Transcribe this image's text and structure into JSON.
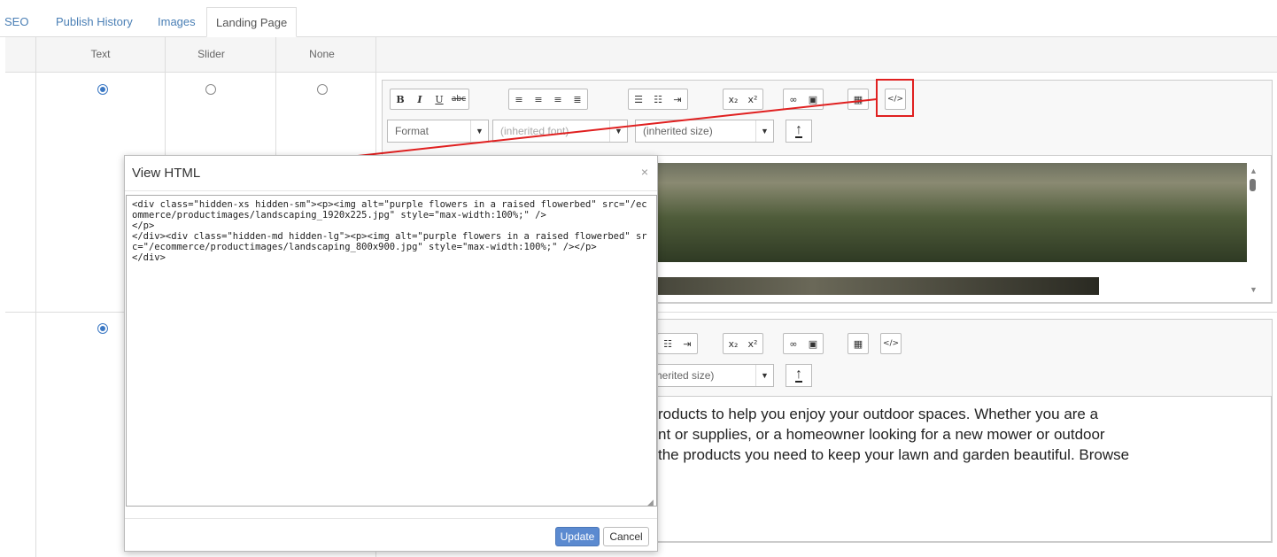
{
  "tabs": [
    {
      "label": "SEO"
    },
    {
      "label": "Publish History"
    },
    {
      "label": "Images"
    },
    {
      "label": "Landing Page",
      "active": true
    }
  ],
  "table": {
    "headers": [
      "Text",
      "Slider",
      "None"
    ]
  },
  "editor": {
    "format_label": "Format",
    "font_label": "(inherited font)",
    "size_label": "(inherited size)",
    "size_label_partial": "herited size)"
  },
  "modal": {
    "title": "View HTML",
    "close_glyph": "×",
    "html_content": "<div class=\"hidden-xs hidden-sm\"><p><img alt=\"purple flowers in a raised flowerbed\" src=\"/ecommerce/productimages/landscaping_1920x225.jpg\" style=\"max-width:100%;\" />\n</p>\n</div><div class=\"hidden-md hidden-lg\"><p><img alt=\"purple flowers in a raised flowerbed\" src=\"/ecommerce/productimages/landscaping_800x900.jpg\" style=\"max-width:100%;\" /></p>\n</div>",
    "update_label": "Update",
    "cancel_label": "Cancel"
  },
  "body_text": {
    "line1": "roducts to help you enjoy your outdoor spaces. Whether you are a",
    "line2": "nt or supplies, or a homeowner looking for a new mower or outdoor",
    "line3": "the products you need to keep your lawn and garden beautiful. Browse"
  },
  "colors": {
    "annotation_red": "#e02020",
    "link_blue": "#4a7fb5",
    "primary_button": "#5b8ad0"
  }
}
